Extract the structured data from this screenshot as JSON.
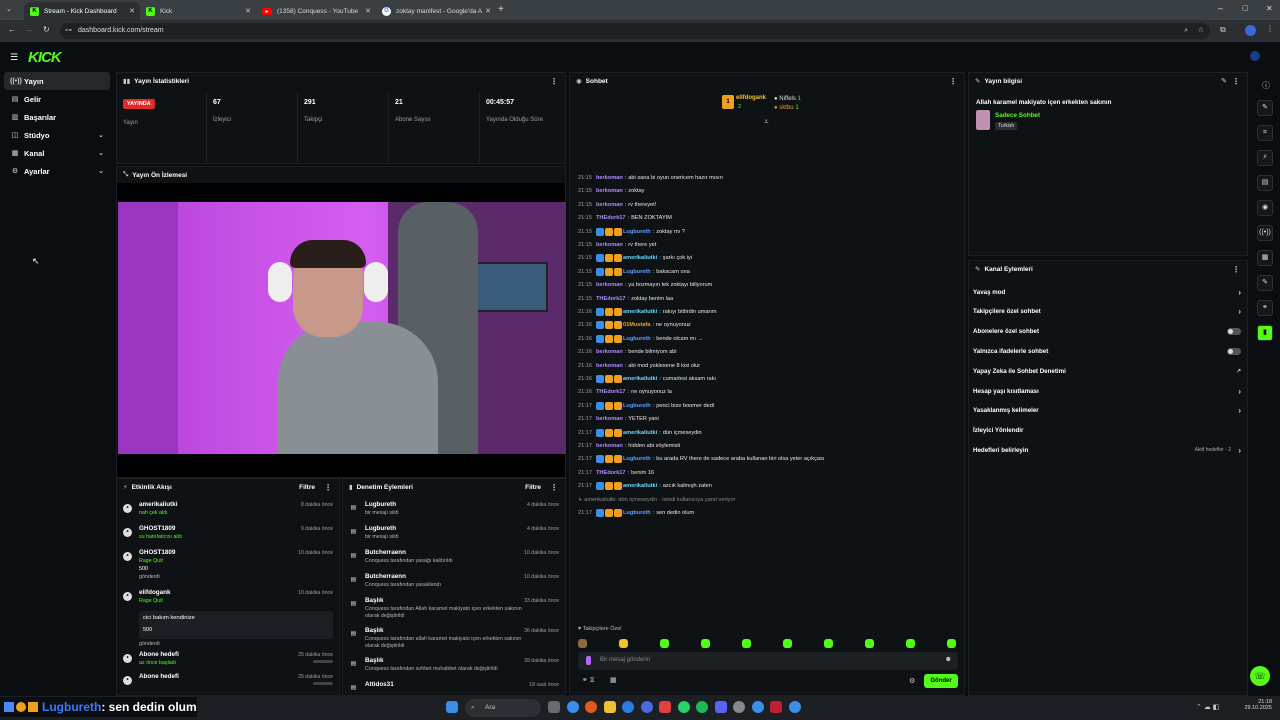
{
  "tabs": [
    {
      "title": "Stream - Kick Dashboard",
      "active": true
    },
    {
      "title": "Kick",
      "active": false
    },
    {
      "title": "(1358) Conquess - YouTube",
      "active": false
    },
    {
      "title": "zoktay manifest - Google'da A",
      "active": false
    }
  ],
  "url": "dashboard.kick.com/stream",
  "logo": "KICK",
  "sidebar": [
    {
      "label": "Yayın",
      "icon": "broadcast-icon",
      "active": true
    },
    {
      "label": "Gelir",
      "icon": "wallet-icon"
    },
    {
      "label": "Başarılar",
      "icon": "trophy-icon"
    },
    {
      "label": "Stüdyo",
      "icon": "studio-icon",
      "expand": true
    },
    {
      "label": "Kanal",
      "icon": "channel-icon",
      "expand": true
    },
    {
      "label": "Ayarlar",
      "icon": "gear-icon",
      "expand": true
    }
  ],
  "stats_panel": {
    "title": "Yayın İstatistikleri",
    "live_badge": "YAYINDA",
    "items": [
      {
        "value": "",
        "label": "Yayın"
      },
      {
        "value": "67",
        "label": "İzleyici"
      },
      {
        "value": "291",
        "label": "Takipçi"
      },
      {
        "value": "21",
        "label": "Abone Sayısı"
      },
      {
        "value": "00:45:57",
        "label": "Yayında Olduğu Süre"
      }
    ]
  },
  "preview_panel": {
    "title": "Yayın Ön İzlemesi"
  },
  "activity_panel": {
    "title": "Etkinlik Akışı",
    "filter": "Filtre",
    "items": [
      {
        "user": "amerikaliutki",
        "desc": "nah çek aldı",
        "time": "8 dakika önce"
      },
      {
        "user": "GHOST1809",
        "desc": "su hatırlatıcısı aldı",
        "time": "9 dakika önce"
      },
      {
        "user": "GHOST1809",
        "desc": "Rage Quit",
        "extra": "500",
        "extra2": "gönderdi",
        "time": "10 dakika önce"
      },
      {
        "user": "elifdogank",
        "desc": "Rage Quit",
        "time": "10 dakika önce"
      },
      {
        "user": "Abone hedefi",
        "desc": "az önce başladı",
        "time": "25 dakika önce"
      },
      {
        "user": "Abone hedefi",
        "desc": "",
        "time": "25 dakika önce"
      }
    ],
    "quote": "cici bakım kendinize",
    "quote_amount": "500",
    "quote_sent": "gönderdi"
  },
  "moderation_panel": {
    "title": "Denetim Eylemleri",
    "filter": "Filtre",
    "items": [
      {
        "user": "Lugbureth",
        "desc": "bir mesajı sildi",
        "time": "4 dakika önce"
      },
      {
        "user": "Lugbureth",
        "desc": "bir mesajı sildi",
        "time": "4 dakika önce"
      },
      {
        "user": "Butcherraenn",
        "desc": "Conquess tarafından yasağı kaldırıldı",
        "time": "10 dakika önce"
      },
      {
        "user": "Butcherraenn",
        "desc": "Conquess tarafından yasaklandı",
        "time": "10 dakika önce"
      },
      {
        "user": "Başlık",
        "desc": "Conquess tarafından Allah karamel makiyato içen erkekten sakının olarak değiştirildi",
        "time": "33 dakika önce"
      },
      {
        "user": "Başlık",
        "desc": "Conquess tarafından allah karamel makiyato içen erkekten sakının olarak değiştirildi",
        "time": "36 dakika önce"
      },
      {
        "user": "Başlık",
        "desc": "Conquess tarafından sohbet muhabbet olarak değiştirildi",
        "time": "39 dakika önce"
      },
      {
        "user": "Attidos31",
        "desc": "",
        "time": "18 saat önce"
      }
    ]
  },
  "chat_panel": {
    "title": "Sohbet",
    "pinned": [
      {
        "name": "elifdogank",
        "num": "2"
      },
      {
        "name": "Niffels",
        "num": "1"
      },
      {
        "name": "sktbu",
        "num": "1"
      }
    ],
    "messages": [
      {
        "ts": "21:15",
        "user": "berkoman",
        "text": "abi sana bi oyun onericem hazır mısın",
        "color": "#b08cff"
      },
      {
        "ts": "21:15",
        "user": "berkoman",
        "text": "zoktay",
        "color": "#b08cff"
      },
      {
        "ts": "21:15",
        "user": "berkoman",
        "text": "rv thereyet!",
        "color": "#b08cff"
      },
      {
        "ts": "21:15",
        "user": "THEdork17",
        "text": "BEN ZOKTAYIM",
        "color": "#b08cff"
      },
      {
        "ts": "21:15",
        "user": "Lugbureth",
        "text": "zoktay mı ?",
        "color": "#5aa0ff",
        "badges": true
      },
      {
        "ts": "21:15",
        "user": "berkoman",
        "text": "rv there yet",
        "color": "#b08cff"
      },
      {
        "ts": "21:15",
        "user": "amerikaliutki",
        "text": "şarkı çok iyi",
        "color": "#6ad8ff",
        "badges": true
      },
      {
        "ts": "21:15",
        "user": "Lugbureth",
        "text": "bakacam ona",
        "color": "#5aa0ff",
        "badges": true
      },
      {
        "ts": "21:15",
        "user": "berkoman",
        "text": "ya bozmayın tek zoktayı biliyorum",
        "color": "#b08cff"
      },
      {
        "ts": "21:15",
        "user": "THEdork17",
        "text": "zoktay benim laa",
        "color": "#b08cff"
      },
      {
        "ts": "21:16",
        "user": "amerikaliutki",
        "text": "rakıyı bittirdin umarım",
        "color": "#6ad8ff",
        "badges": true
      },
      {
        "ts": "21:16",
        "user": "01Mustafa",
        "text": "ne oynuyonuz",
        "color": "#f0a030",
        "badges": true
      },
      {
        "ts": "21:16",
        "user": "Lugbureth",
        "text": "bende olcam mı →",
        "color": "#5aa0ff",
        "badges": true
      },
      {
        "ts": "21:16",
        "user": "berkoman",
        "text": "bende bilmiyom abi",
        "color": "#b08cff"
      },
      {
        "ts": "21:16",
        "user": "berkoman",
        "text": "abi mod yuklesene 8 kisi olur",
        "color": "#b08cff"
      },
      {
        "ts": "21:16",
        "user": "amerikaliutki",
        "text": "cumartesi aksam rakı",
        "color": "#6ad8ff",
        "badges": true
      },
      {
        "ts": "21:16",
        "user": "THEdork17",
        "text": "ne oynuyonuz la",
        "color": "#b08cff"
      },
      {
        "ts": "21:17",
        "user": "Lugbureth",
        "text": "penci bize boomer dedi",
        "color": "#5aa0ff",
        "badges": true
      },
      {
        "ts": "21:17",
        "user": "berkoman",
        "text": "YETER yani",
        "color": "#b08cff"
      },
      {
        "ts": "21:17",
        "user": "amerikaliutki",
        "text": "dün içmeseydin",
        "color": "#6ad8ff",
        "badges": true
      },
      {
        "ts": "21:17",
        "user": "berkoman",
        "text": "hidden abi söylemisti",
        "color": "#b08cff"
      },
      {
        "ts": "21:17",
        "user": "Lugbureth",
        "text": "bu arada RV there de sadece araba kullanan biri olsa yeter açıkçası",
        "color": "#5aa0ff",
        "badges": true
      },
      {
        "ts": "21:17",
        "user": "THEdork17",
        "text": "benim 16",
        "color": "#b08cff"
      },
      {
        "ts": "21:17",
        "user": "amerikaliutki",
        "text": "azcık kalmışh zaten",
        "color": "#6ad8ff",
        "badges": true
      },
      {
        "ts": "",
        "user": "",
        "text": "↳ amerikaliutki: dün içmeseydin · istedi kullanıcıya yanıt veriyor",
        "color": "#888"
      },
      {
        "ts": "21:17",
        "user": "Lugbureth",
        "text": "sen dedin olum",
        "color": "#5aa0ff",
        "badges": true
      }
    ],
    "followers_only": "Takipçilere Özel",
    "input_placeholder": "Bir mesaj gönderin",
    "send": "Gönder"
  },
  "stream_info": {
    "title": "Yayın bilgisi",
    "stream_title": "Allah karamel makiyato içen erkekten sakının",
    "category": "Sadece Sohbet",
    "language": "Turkish"
  },
  "channel_actions": {
    "title": "Kanal Eylemleri",
    "items": [
      {
        "label": "Yavaş mod",
        "type": "chevron"
      },
      {
        "label": "Takipçilere özel sohbet",
        "type": "chevron"
      },
      {
        "label": "Abonelere özel sohbet",
        "type": "toggle"
      },
      {
        "label": "Yalnızca ifadelerle sohbet",
        "type": "toggle"
      },
      {
        "label": "Yapay Zeka ile Sohbet Denetimi",
        "type": "external"
      },
      {
        "label": "Hesap yaşı kısıtlaması",
        "type": "chevron"
      },
      {
        "label": "Yasaklanmış kelimeler",
        "type": "chevron"
      },
      {
        "label": "İzleyici Yönlendir",
        "type": "none"
      },
      {
        "label": "Hedefleri belirleyin",
        "type": "goal"
      }
    ],
    "goal_text": "Aktif hedefler - 2"
  },
  "overlay_text": {
    "user": "Lugbureth",
    "text": ": sen dedin olum"
  },
  "taskbar": {
    "search": "Ara",
    "time": "21:18",
    "date": "29.10.2025"
  },
  "colors": {
    "accent": "#53fc18",
    "live": "#e02b2b",
    "bg": "#0b0e10"
  }
}
